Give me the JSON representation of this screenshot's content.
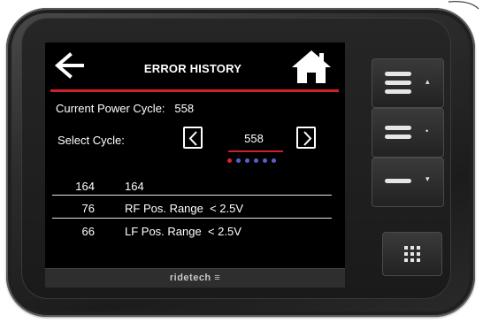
{
  "screen": {
    "title": "ERROR HISTORY",
    "power_cycle_label": "Current Power Cycle:",
    "power_cycle_value": "558",
    "select_cycle_label": "Select Cycle:",
    "selected_cycle": "558",
    "page_dots_total": 6,
    "page_dots_active": 1,
    "errors": [
      {
        "code": "164",
        "description": "164"
      },
      {
        "code": "76",
        "description": "RF Pos. Range  < 2.5V"
      },
      {
        "code": "66",
        "description": "LF Pos. Range  < 2.5V"
      }
    ],
    "footer_brand": "ridetech ≡"
  },
  "hardware_buttons": [
    {
      "name": "up-button",
      "symbol": "▴"
    },
    {
      "name": "select-button",
      "symbol": "•"
    },
    {
      "name": "down-button",
      "symbol": "▾"
    },
    {
      "name": "menu-grid-button",
      "symbol": ""
    }
  ],
  "colors": {
    "accent_red": "#d0202a",
    "dot_blue": "#5c5ec8",
    "screen_bg": "#000000",
    "text": "#ffffff"
  }
}
